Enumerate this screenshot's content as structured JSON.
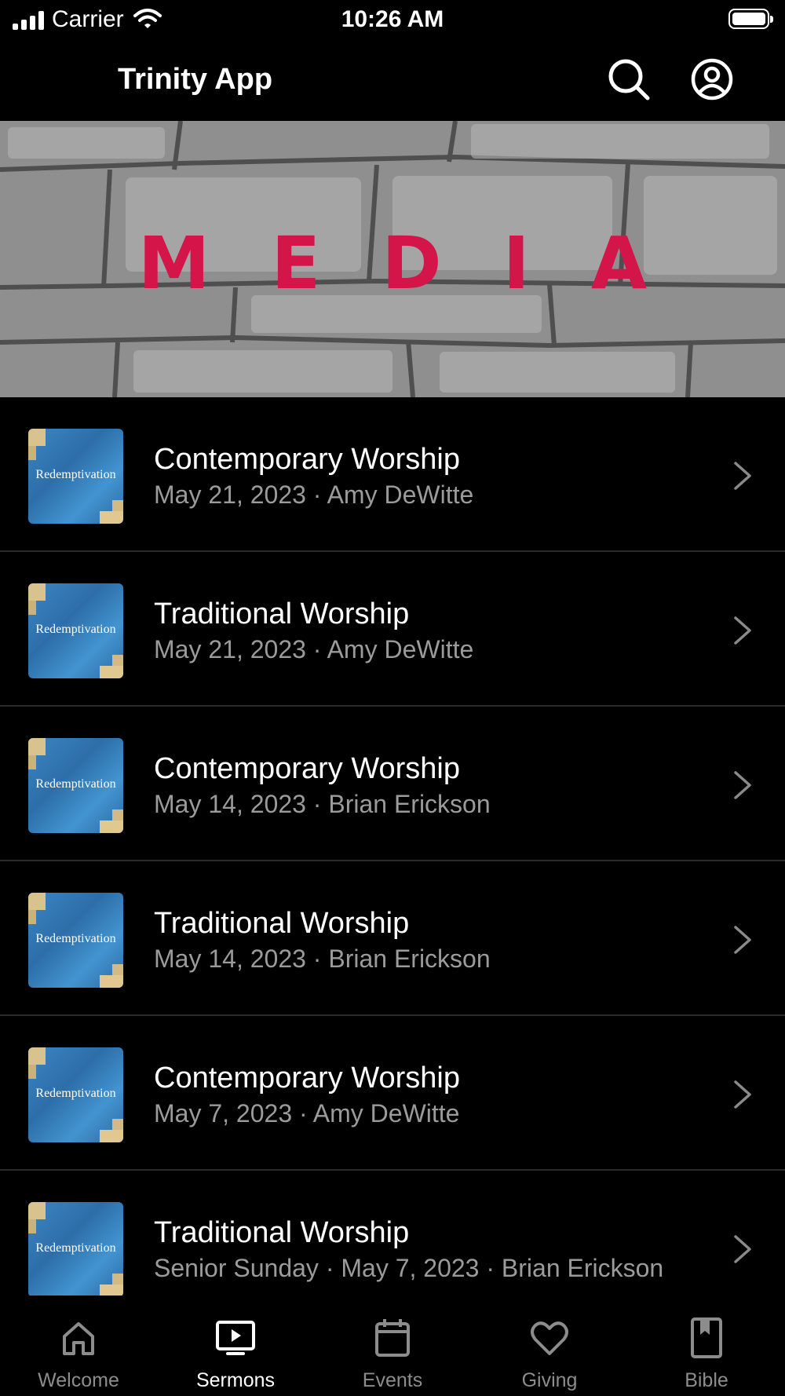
{
  "status_bar": {
    "carrier": "Carrier",
    "time": "10:26 AM"
  },
  "header": {
    "title": "Trinity App"
  },
  "banner": {
    "text": "MEDIA",
    "accent": "#d4154a"
  },
  "list": {
    "items": [
      {
        "title": "Contemporary Worship",
        "subtitle": "May 21, 2023 · Amy DeWitte",
        "thumb": "Redemptivation"
      },
      {
        "title": "Traditional Worship",
        "subtitle": "May 21, 2023 · Amy DeWitte",
        "thumb": "Redemptivation"
      },
      {
        "title": "Contemporary Worship",
        "subtitle": "May 14, 2023 · Brian Erickson",
        "thumb": "Redemptivation"
      },
      {
        "title": "Traditional Worship",
        "subtitle": "May 14, 2023 · Brian Erickson",
        "thumb": "Redemptivation"
      },
      {
        "title": "Contemporary Worship",
        "subtitle": "May 7, 2023 · Amy DeWitte",
        "thumb": "Redemptivation"
      },
      {
        "title": "Traditional Worship",
        "subtitle": "Senior Sunday · May 7, 2023 · Brian Erickson",
        "thumb": "Redemptivation"
      }
    ]
  },
  "tabs": [
    {
      "label": "Welcome",
      "icon": "home-icon"
    },
    {
      "label": "Sermons",
      "icon": "play-tv-icon",
      "active": true
    },
    {
      "label": "Events",
      "icon": "calendar-icon"
    },
    {
      "label": "Giving",
      "icon": "heart-icon"
    },
    {
      "label": "Bible",
      "icon": "book-icon"
    }
  ]
}
